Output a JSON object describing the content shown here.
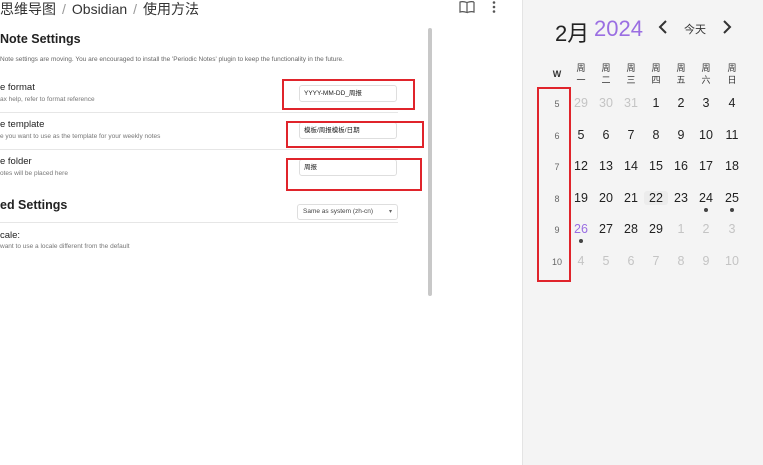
{
  "breadcrumb": {
    "item1": "思维导图",
    "item2": "Obsidian",
    "item3": "使用方法"
  },
  "icons": {
    "book": "book-open-icon",
    "more": "more-vertical-icon"
  },
  "settings": {
    "section_title": "Note Settings",
    "notice": "Note settings are moving. You are encouraged to install the 'Periodic Notes' plugin to keep the functionality in the future.",
    "format": {
      "label": "e format",
      "desc": "ax help, refer to format reference",
      "value": "YYYY-MM-DD_周报"
    },
    "template": {
      "label": "e template",
      "desc": "e you want to use as the template for your weekly notes",
      "value": "模板/周报模板/日期"
    },
    "folder": {
      "label": "e folder",
      "desc": "otes will be placed here",
      "value": "周报"
    },
    "advanced_title": "ed Settings",
    "locale": {
      "label": "cale:",
      "desc": "want to use a locale different from the default",
      "value": "Same as system (zh-cn)"
    }
  },
  "calendar": {
    "month": "2月",
    "year": "2024",
    "today_label": "今天",
    "week_header": "W",
    "weekdays": [
      "周一",
      "周二",
      "周三",
      "周四",
      "周五",
      "周六",
      "周日"
    ],
    "accent_color": "#9a6ee2",
    "weeks": [
      {
        "num": "5",
        "days": [
          "29",
          "30",
          "31",
          "1",
          "2",
          "3",
          "4"
        ]
      },
      {
        "num": "6",
        "days": [
          "5",
          "6",
          "7",
          "8",
          "9",
          "10",
          "11"
        ]
      },
      {
        "num": "7",
        "days": [
          "12",
          "13",
          "14",
          "15",
          "16",
          "17",
          "18"
        ]
      },
      {
        "num": "8",
        "days": [
          "19",
          "20",
          "21",
          "22",
          "23",
          "24",
          "25"
        ]
      },
      {
        "num": "9",
        "days": [
          "26",
          "27",
          "28",
          "29",
          "1",
          "2",
          "3"
        ]
      },
      {
        "num": "10",
        "days": [
          "4",
          "5",
          "6",
          "7",
          "8",
          "9",
          "10"
        ]
      }
    ]
  }
}
